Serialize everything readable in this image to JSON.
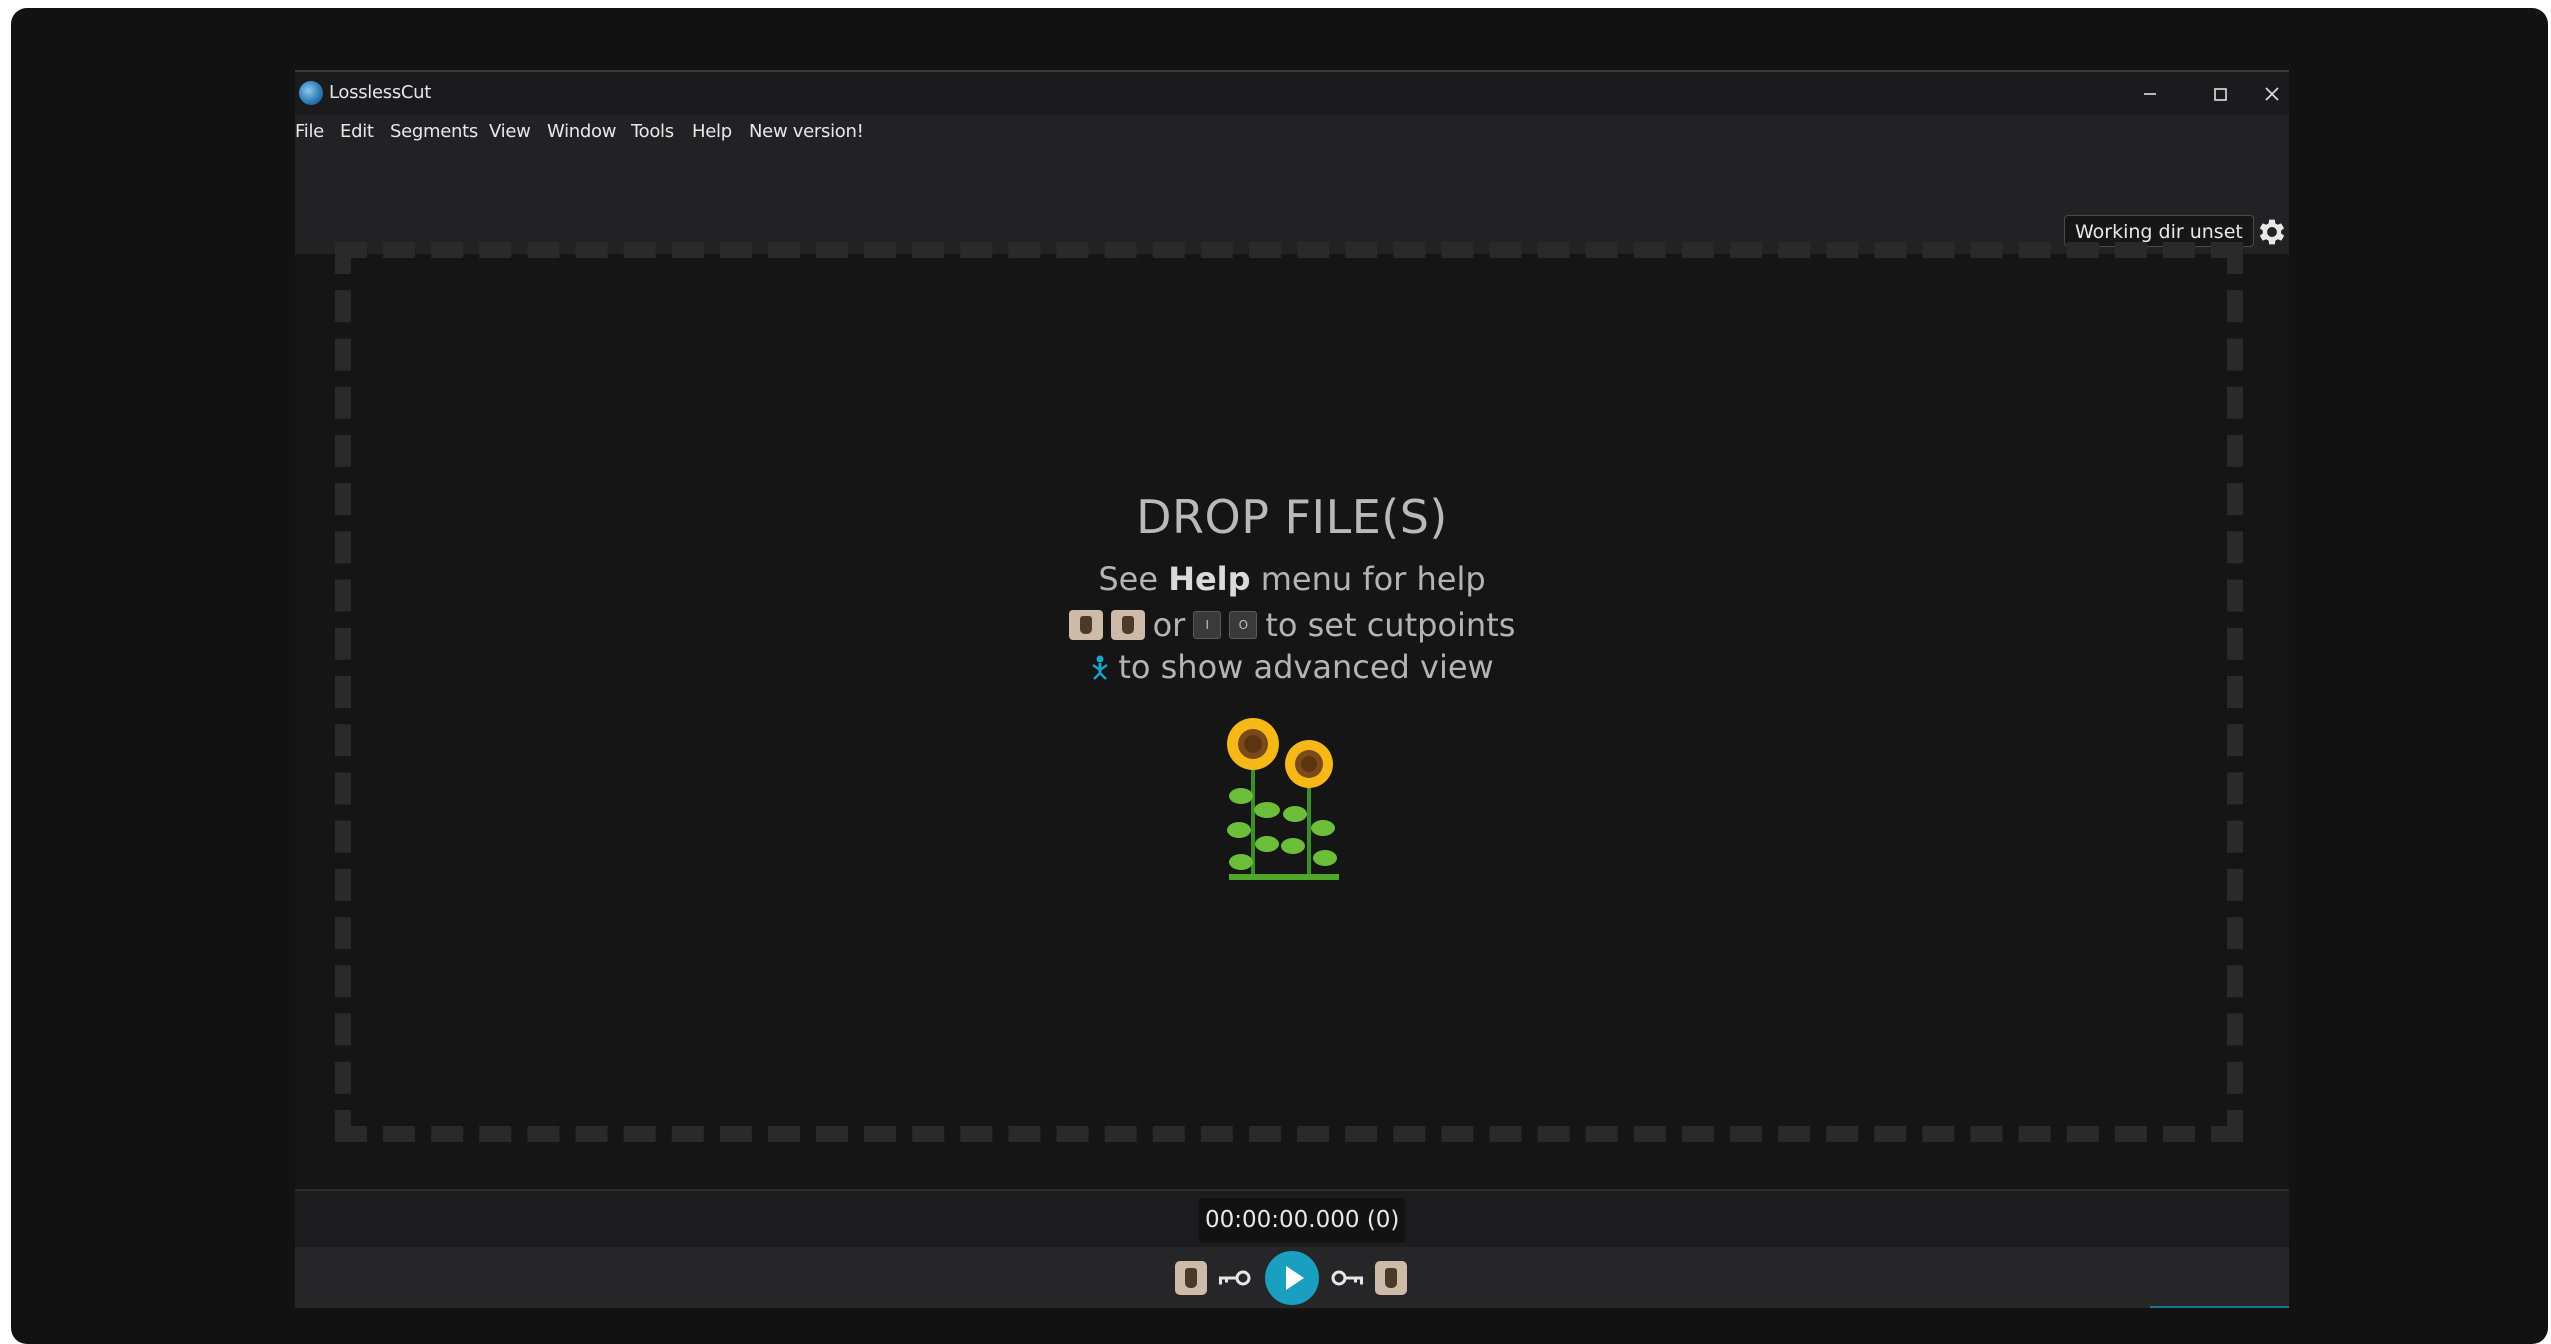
{
  "window": {
    "title": "LosslessCut",
    "controls": [
      "minimize",
      "maximize",
      "close"
    ]
  },
  "menu": {
    "items": [
      "File",
      "Edit",
      "Segments",
      "View",
      "Window",
      "Tools",
      "Help",
      "New version!"
    ]
  },
  "top_bar": {
    "working_dir_label": "Working dir unset",
    "settings_icon": "gear-icon"
  },
  "drop_zone": {
    "title": "DROP FILE(S)",
    "help_prefix": "See",
    "help_bold": "Help",
    "help_suffix": "menu for help",
    "cut_or": "or",
    "cut_key_start": "I",
    "cut_key_end": "O",
    "cut_suffix": "to set cutpoints",
    "advanced_text": "to show advanced view",
    "illustration": "sunflowers"
  },
  "timeline": {
    "time_display": "00:00:00.000 (0)"
  },
  "colors": {
    "accent": "#1a9fc0",
    "background": "#151515",
    "bar": "#222224"
  }
}
